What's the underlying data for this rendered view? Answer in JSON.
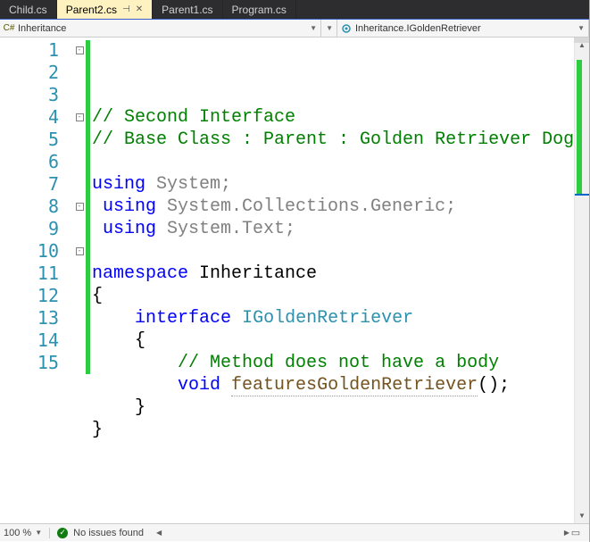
{
  "tabs": [
    {
      "label": "Child.cs",
      "active": false
    },
    {
      "label": "Parent2.cs",
      "active": true
    },
    {
      "label": "Parent1.cs",
      "active": false
    },
    {
      "label": "Program.cs",
      "active": false
    }
  ],
  "nav": {
    "scope": "Inheritance",
    "member": "Inheritance.IGoldenRetriever"
  },
  "code": {
    "lines": [
      {
        "n": 1,
        "fold": "box",
        "segs": [
          {
            "t": "// Second Interface",
            "c": "c-comment"
          }
        ]
      },
      {
        "n": 2,
        "segs": [
          {
            "t": "// Base Class : Parent : Golden Retriever Dog Breed",
            "c": "c-comment"
          }
        ]
      },
      {
        "n": 3,
        "segs": []
      },
      {
        "n": 4,
        "fold": "box",
        "segs": [
          {
            "t": "using",
            "c": "c-keyword"
          },
          {
            "t": " System;",
            "c": "c-text"
          }
        ]
      },
      {
        "n": 5,
        "segs": [
          {
            "t": " using",
            "c": "c-keyword"
          },
          {
            "t": " System.Collections.Generic;",
            "c": "c-text"
          }
        ]
      },
      {
        "n": 6,
        "segs": [
          {
            "t": " using",
            "c": "c-keyword"
          },
          {
            "t": " System.Text;",
            "c": "c-text"
          }
        ]
      },
      {
        "n": 7,
        "segs": []
      },
      {
        "n": 8,
        "fold": "box",
        "segs": [
          {
            "t": "namespace",
            "c": "c-keyword"
          },
          {
            "t": " Inheritance",
            "c": ""
          }
        ]
      },
      {
        "n": 9,
        "segs": [
          {
            "t": "{",
            "c": ""
          }
        ]
      },
      {
        "n": 10,
        "fold": "box",
        "indent": 1,
        "segs": [
          {
            "t": "interface",
            "c": "c-keyword"
          },
          {
            "t": " ",
            "c": ""
          },
          {
            "t": "IGoldenRetriever",
            "c": "c-type"
          }
        ]
      },
      {
        "n": 11,
        "indent": 1,
        "segs": [
          {
            "t": "{",
            "c": ""
          }
        ]
      },
      {
        "n": 12,
        "indent": 2,
        "segs": [
          {
            "t": "// Method does not have a body",
            "c": "c-comment"
          }
        ]
      },
      {
        "n": 13,
        "indent": 2,
        "segs": [
          {
            "t": "void",
            "c": "c-keyword"
          },
          {
            "t": " ",
            "c": ""
          },
          {
            "t": "featuresGoldenRetriever",
            "c": "c-method"
          },
          {
            "t": "();",
            "c": ""
          }
        ]
      },
      {
        "n": 14,
        "indent": 1,
        "segs": [
          {
            "t": "}",
            "c": ""
          }
        ]
      },
      {
        "n": 15,
        "segs": [
          {
            "t": "}",
            "c": ""
          }
        ]
      }
    ]
  },
  "status": {
    "zoom": "100 %",
    "issues": "No issues found"
  }
}
